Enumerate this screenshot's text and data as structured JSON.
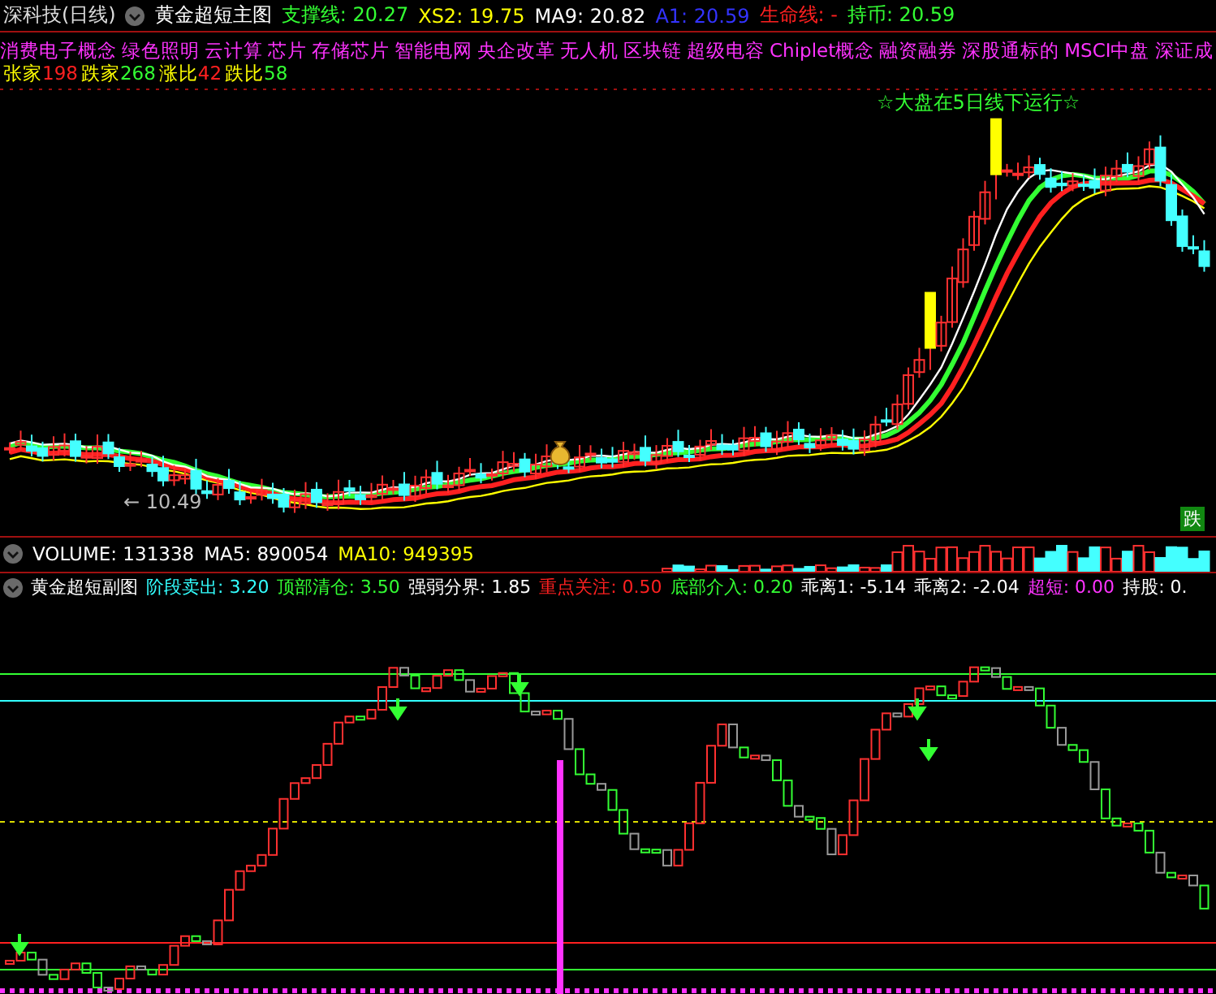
{
  "header": {
    "title": "深科技(日线)",
    "indicator": "黄金超短主图",
    "values": [
      {
        "text": "支撑线: 20.27",
        "color": "#33ff33"
      },
      {
        "text": "XS2: 19.75",
        "color": "#ffff00"
      },
      {
        "text": "MA9: 20.82",
        "color": "#ffffff"
      },
      {
        "text": "A1: 20.59",
        "color": "#3333ff"
      },
      {
        "text": "生命线: -",
        "color": "#ff2020"
      },
      {
        "text": "持币: 20.59",
        "color": "#33ff33"
      }
    ]
  },
  "concepts": [
    "消费电子概念",
    "绿色照明",
    "云计算",
    "芯片",
    "存储芯片",
    "智能电网",
    "央企改革",
    "无人机",
    "区块链",
    "超级电容",
    "Chiplet概念",
    "融资融券",
    "深股通标的",
    "MSCI中盘",
    "深证成"
  ],
  "breadth": [
    {
      "label": "张家",
      "value": "198",
      "color": "#ff2020"
    },
    {
      "label": "跌家",
      "value": "268",
      "color": "#33ff33"
    },
    {
      "label": "涨比",
      "value": "42",
      "color": "#ff2020"
    },
    {
      "label": "跌比",
      "value": "58",
      "color": "#33ff33"
    }
  ],
  "main_chart": {
    "notice": "☆大盘在5日线下运行☆",
    "low_label": "← 10.49",
    "signal": "跌"
  },
  "volume": {
    "values": [
      {
        "text": "VOLUME: 131338",
        "color": "#ffffff"
      },
      {
        "text": "MA5: 890054",
        "color": "#ffffff"
      },
      {
        "text": "MA10: 949395",
        "color": "#ffff00"
      }
    ]
  },
  "sub_chart": {
    "indicator": "黄金超短副图",
    "values": [
      {
        "text": "阶段卖出: 3.20",
        "color": "#33ffff"
      },
      {
        "text": "顶部清仓: 3.50",
        "color": "#33ff33"
      },
      {
        "text": "强弱分界: 1.85",
        "color": "#ffffff"
      },
      {
        "text": "重点关注: 0.50",
        "color": "#ff2020"
      },
      {
        "text": "底部介入: 0.20",
        "color": "#33ff33"
      },
      {
        "text": "乖离1: -5.14",
        "color": "#ffffff"
      },
      {
        "text": "乖离2: -2.04",
        "color": "#ffffff"
      },
      {
        "text": "超短: 0.00",
        "color": "#ff33ff"
      },
      {
        "text": "持股: 0.",
        "color": "#ffffff"
      }
    ]
  }
}
